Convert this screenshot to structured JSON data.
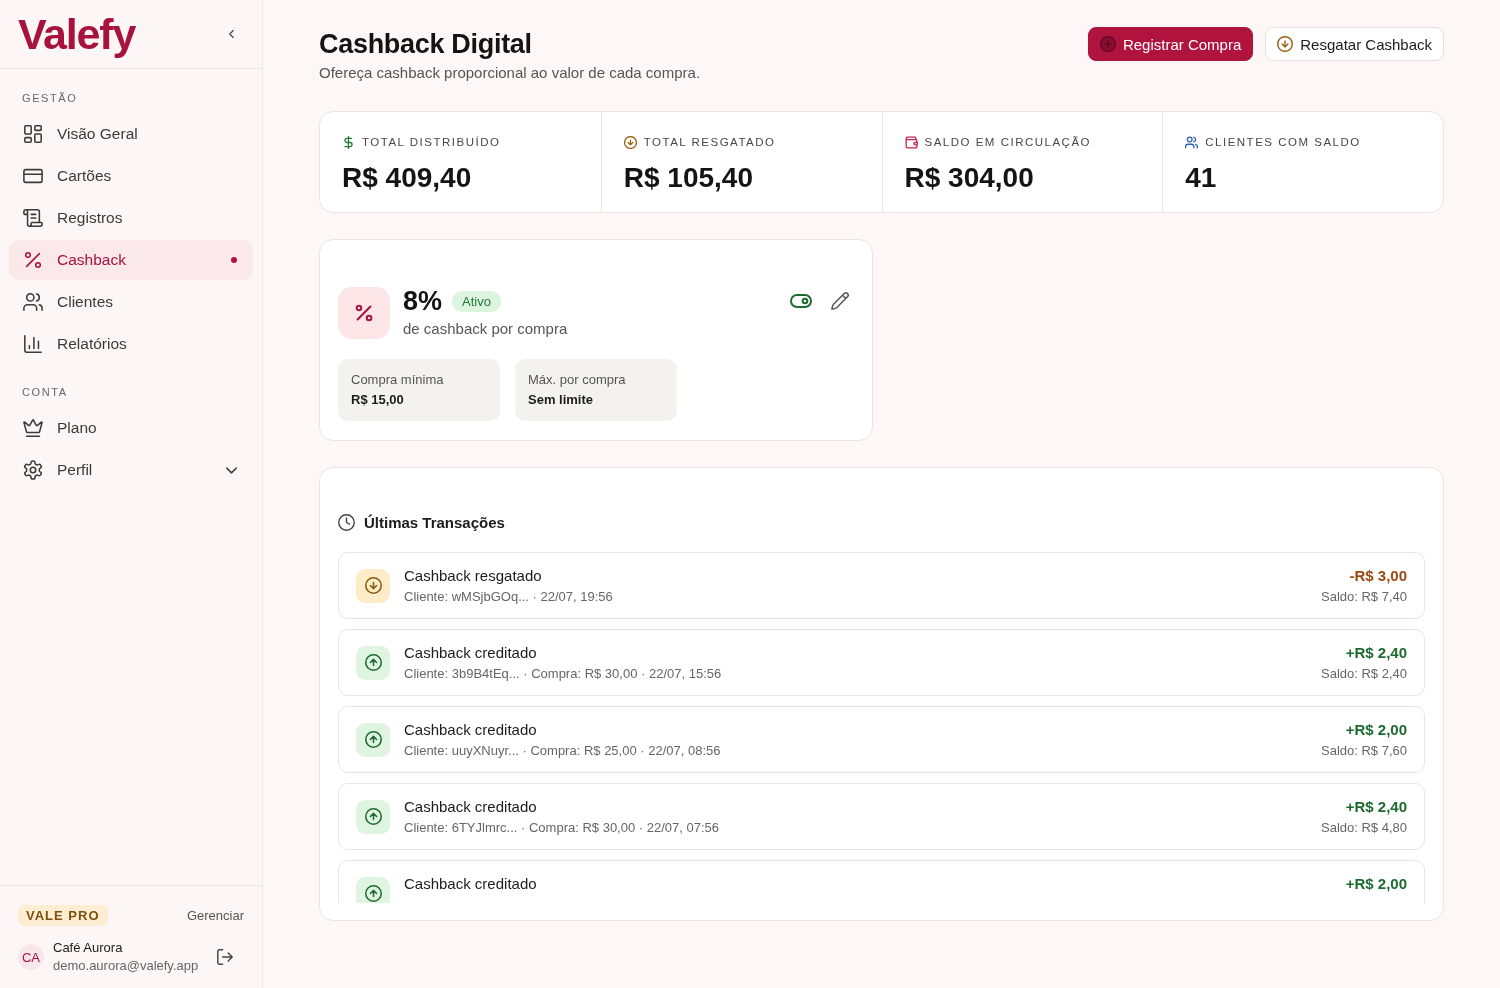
{
  "sidebar": {
    "logo": "Valefy",
    "sections": [
      {
        "title": "GESTÃO",
        "items": [
          {
            "label": "Visão Geral",
            "kind": "link",
            "selected": false
          },
          {
            "label": "Cartões",
            "kind": "link",
            "selected": false
          },
          {
            "label": "Registros",
            "kind": "link",
            "selected": false
          },
          {
            "label": "Cashback",
            "kind": "link",
            "selected": true
          },
          {
            "label": "Clientes",
            "kind": "link",
            "selected": false
          },
          {
            "label": "Relatórios",
            "kind": "link",
            "selected": false
          }
        ]
      },
      {
        "title": "CONTA",
        "items": [
          {
            "label": "Plano",
            "kind": "link",
            "selected": false
          },
          {
            "label": "Perfil",
            "kind": "group",
            "selected": false,
            "expanded": false
          }
        ]
      }
    ],
    "plan": {
      "badge": "VALE PRO",
      "action": "Gerenciar"
    },
    "user": {
      "initials": "CA",
      "name": "Café Aurora",
      "email": "demo.aurora@valefy.app"
    }
  },
  "header": {
    "title": "Cashback Digital",
    "subtitle": "Ofereça cashback proporcional ao valor de cada compra.",
    "buttons": [
      {
        "label": "Registrar Compra",
        "kind": "primary"
      },
      {
        "label": "Resgatar Cashback",
        "kind": "secondary"
      }
    ]
  },
  "stats": [
    {
      "kind": "distributed",
      "label": "TOTAL DISTRIBUÍDO",
      "value": "R$ 409,40"
    },
    {
      "kind": "redeemed",
      "label": "TOTAL RESGATADO",
      "value": "R$ 105,40"
    },
    {
      "kind": "balance",
      "label": "SALDO EM CIRCULAÇÃO",
      "value": "R$ 304,00"
    },
    {
      "kind": "clients",
      "label": "CLIENTES COM SALDO",
      "value": "41"
    }
  ],
  "program": {
    "rate": "8%",
    "status": "Ativo",
    "active": true,
    "caption": "de cashback por compra",
    "limits": [
      {
        "label": "Compra mínima",
        "value": "R$ 15,00"
      },
      {
        "label": "Máx. por compra",
        "value": "Sem limite"
      }
    ]
  },
  "transactions": {
    "title": "Últimas Transações",
    "rows": [
      {
        "kind": "redeemed",
        "title": "Cashback resgatado",
        "detail": "Cliente: wMSjbGOq... · 22/07, 19:56",
        "amount": "-R$ 3,00",
        "balance": "Saldo: R$ 7,40"
      },
      {
        "kind": "credited",
        "title": "Cashback creditado",
        "detail": "Cliente: 3b9B4tEq... · Compra: R$ 30,00 · 22/07, 15:56",
        "amount": "+R$ 2,40",
        "balance": "Saldo: R$ 2,40"
      },
      {
        "kind": "credited",
        "title": "Cashback creditado",
        "detail": "Cliente: uuyXNuyr... · Compra: R$ 25,00 · 22/07, 08:56",
        "amount": "+R$ 2,00",
        "balance": "Saldo: R$ 7,60"
      },
      {
        "kind": "credited",
        "title": "Cashback creditado",
        "detail": "Cliente: 6TYJlmrc... · Compra: R$ 30,00 · 22/07, 07:56",
        "amount": "+R$ 2,40",
        "balance": "Saldo: R$ 4,80"
      },
      {
        "kind": "credited",
        "title": "Cashback creditado",
        "amount": "+R$ 2,00"
      }
    ]
  }
}
